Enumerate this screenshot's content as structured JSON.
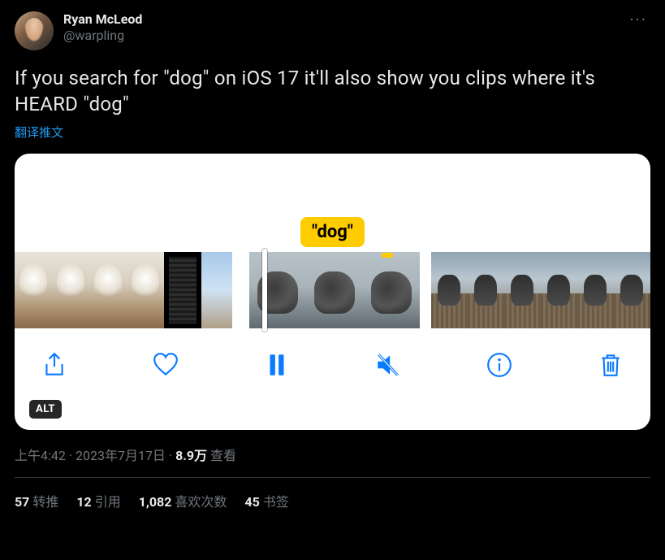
{
  "user": {
    "display_name": "Ryan McLeod",
    "handle": "@warpling"
  },
  "more_label": "···",
  "body_text": "If you search for \"dog\" on iOS 17 it'll also show you clips where it's HEARD \"dog\"",
  "translate_label": "翻译推文",
  "media": {
    "caption_bubble": "\"dog\"",
    "alt_badge": "ALT",
    "toolbar": {
      "share": "share",
      "like": "like",
      "pause": "pause",
      "mute": "mute",
      "info": "info",
      "trash": "trash"
    }
  },
  "meta": {
    "time": "上午4:42",
    "sep1": " · ",
    "date": "2023年7月17日",
    "sep2": " · ",
    "views_num": "8.9万",
    "views_label": " 查看"
  },
  "stats": {
    "retweets_num": "57",
    "retweets_label": "转推",
    "quotes_num": "12",
    "quotes_label": "引用",
    "likes_num": "1,082",
    "likes_label": "喜欢次数",
    "bookmarks_num": "45",
    "bookmarks_label": "书签"
  }
}
